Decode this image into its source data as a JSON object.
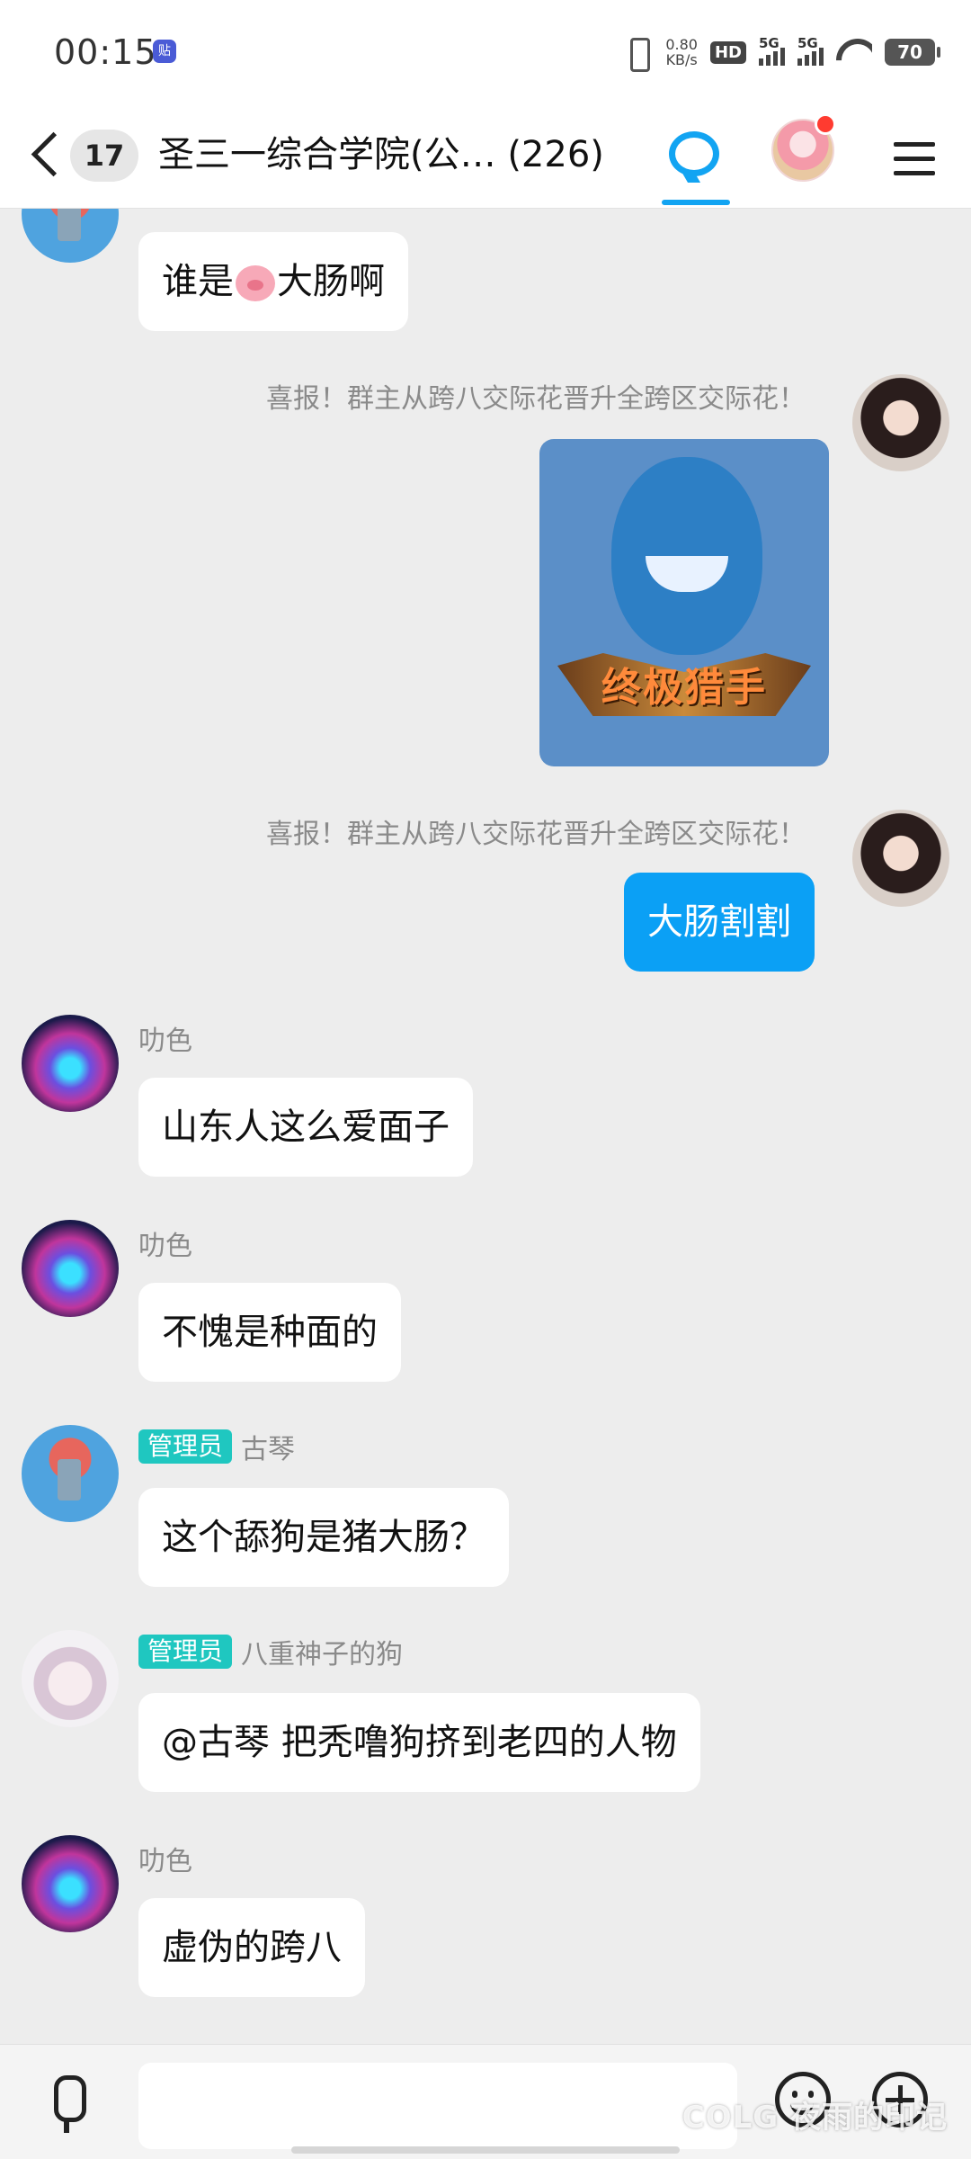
{
  "status_bar": {
    "time": "00:15",
    "app_icon_text": "贴",
    "net_speed_value": "0.80",
    "net_speed_unit": "KB/s",
    "hd_label": "HD",
    "sim1_label": "5G",
    "sim2_label": "5G",
    "battery": "70"
  },
  "header": {
    "unread_count": "17",
    "group_title": "圣三一综合学院(公… (226)"
  },
  "messages": [
    {
      "text_before": "谁是",
      "emoji": "pig-face",
      "text_after": "大肠啊"
    },
    {
      "announcement": "喜报！群主从跨八交际花晋升全跨区交际花！",
      "image_caption": "终极猎手"
    },
    {
      "announcement": "喜报！群主从跨八交际花晋升全跨区交际花！",
      "text": "大肠割割"
    },
    {
      "sender": "叻色",
      "text": "山东人这么爱面子"
    },
    {
      "sender": "叻色",
      "text": "不愧是种面的"
    },
    {
      "tag": "管理员",
      "sender": "古琴",
      "text": "这个舔狗是猪大肠？"
    },
    {
      "tag": "管理员",
      "sender": "八重神子的狗",
      "text": "@古琴 把秃噜狗挤到老四的人物"
    },
    {
      "sender": "叻色",
      "text": "虚伪的跨八"
    }
  ],
  "input": {
    "placeholder": ""
  },
  "watermark": "COLG 夜雨的印记",
  "colors": {
    "accent": "#12a4f2",
    "self_bubble": "#0ba0f5",
    "admin_tag": "#1fc7c0",
    "badge_dot": "#ff3b30"
  }
}
